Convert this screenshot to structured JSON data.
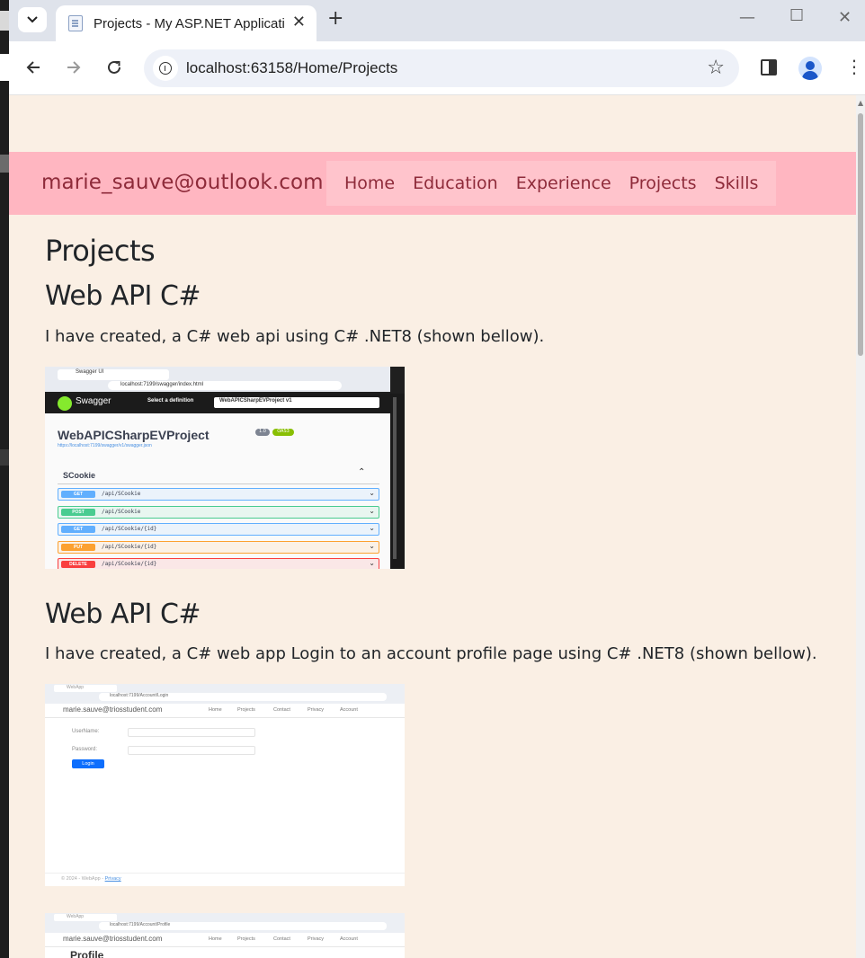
{
  "browser": {
    "tab_title": "Projects - My ASP.NET Application",
    "url": "localhost:63158/Home/Projects",
    "new_tab_glyph": "+",
    "icons": [
      "tab-search-icon",
      "page-favicon",
      "close-icon",
      "new-tab-icon",
      "minimize-icon",
      "maximize-icon",
      "window-close-icon",
      "back-icon",
      "forward-icon",
      "reload-icon",
      "site-info-icon",
      "bookmark-star-icon",
      "side-panel-icon",
      "profile-avatar-icon",
      "menu-kebab-icon"
    ]
  },
  "site": {
    "brand": "marie_sauve@outlook.com",
    "nav": [
      "Home",
      "Education",
      "Experience",
      "Projects",
      "Skills"
    ],
    "colors": {
      "navbar_bg": "#ffb6c1",
      "nav_text": "#8e2b3a",
      "page_bg": "#faefe4"
    }
  },
  "page": {
    "title": "Projects",
    "projects": [
      {
        "heading": "Web API C#",
        "description": "I have created, a C# web api using C# .NET8 (shown bellow)."
      },
      {
        "heading": "Web API C#",
        "description": "I have created, a C# web app Login to an account profile page using C# .NET8 (shown bellow)."
      }
    ]
  },
  "screenshots": {
    "swagger": {
      "tab": "Swagger UI",
      "url": "localhost:7199/swagger/index.html",
      "logo_text": "Swagger",
      "select_label": "Select a definition",
      "definition": "WebAPICSharpEVProject v1",
      "api_title": "WebAPICSharpEVProject",
      "version": "1.0",
      "oas": "OAS3",
      "spec_link": "https://localhost:7199/swagger/v1/swagger.json",
      "tag": "SCookie",
      "ops": [
        {
          "method": "GET",
          "path": "/api/SCookie",
          "color": "#61affe",
          "bg": "#ebf3fb"
        },
        {
          "method": "POST",
          "path": "/api/SCookie",
          "color": "#49cc90",
          "bg": "#e8f6f0"
        },
        {
          "method": "GET",
          "path": "/api/SCookie/{id}",
          "color": "#61affe",
          "bg": "#ebf3fb"
        },
        {
          "method": "PUT",
          "path": "/api/SCookie/{id}",
          "color": "#fca130",
          "bg": "#fbf1e6"
        },
        {
          "method": "DELETE",
          "path": "/api/SCookie/{id}",
          "color": "#f93e3e",
          "bg": "#fae7e7"
        }
      ]
    },
    "login": {
      "tab": "WebApp",
      "url": "localhost:7199/Account/Login",
      "brand": "marie.sauve@triosstudent.com",
      "nav": [
        "Home",
        "Projects",
        "Contact",
        "Privacy",
        "Account"
      ],
      "username_label": "UserName:",
      "password_label": "Password:",
      "button": "Login",
      "footer": "© 2024 - WebApp - ",
      "footer_link": "Privacy"
    },
    "profile": {
      "tab": "WebApp",
      "url": "localhost:7199/Account/Profile",
      "brand": "marie.sauve@triosstudent.com",
      "nav": [
        "Home",
        "Projects",
        "Contact",
        "Privacy",
        "Account"
      ],
      "title": "Profile"
    }
  }
}
